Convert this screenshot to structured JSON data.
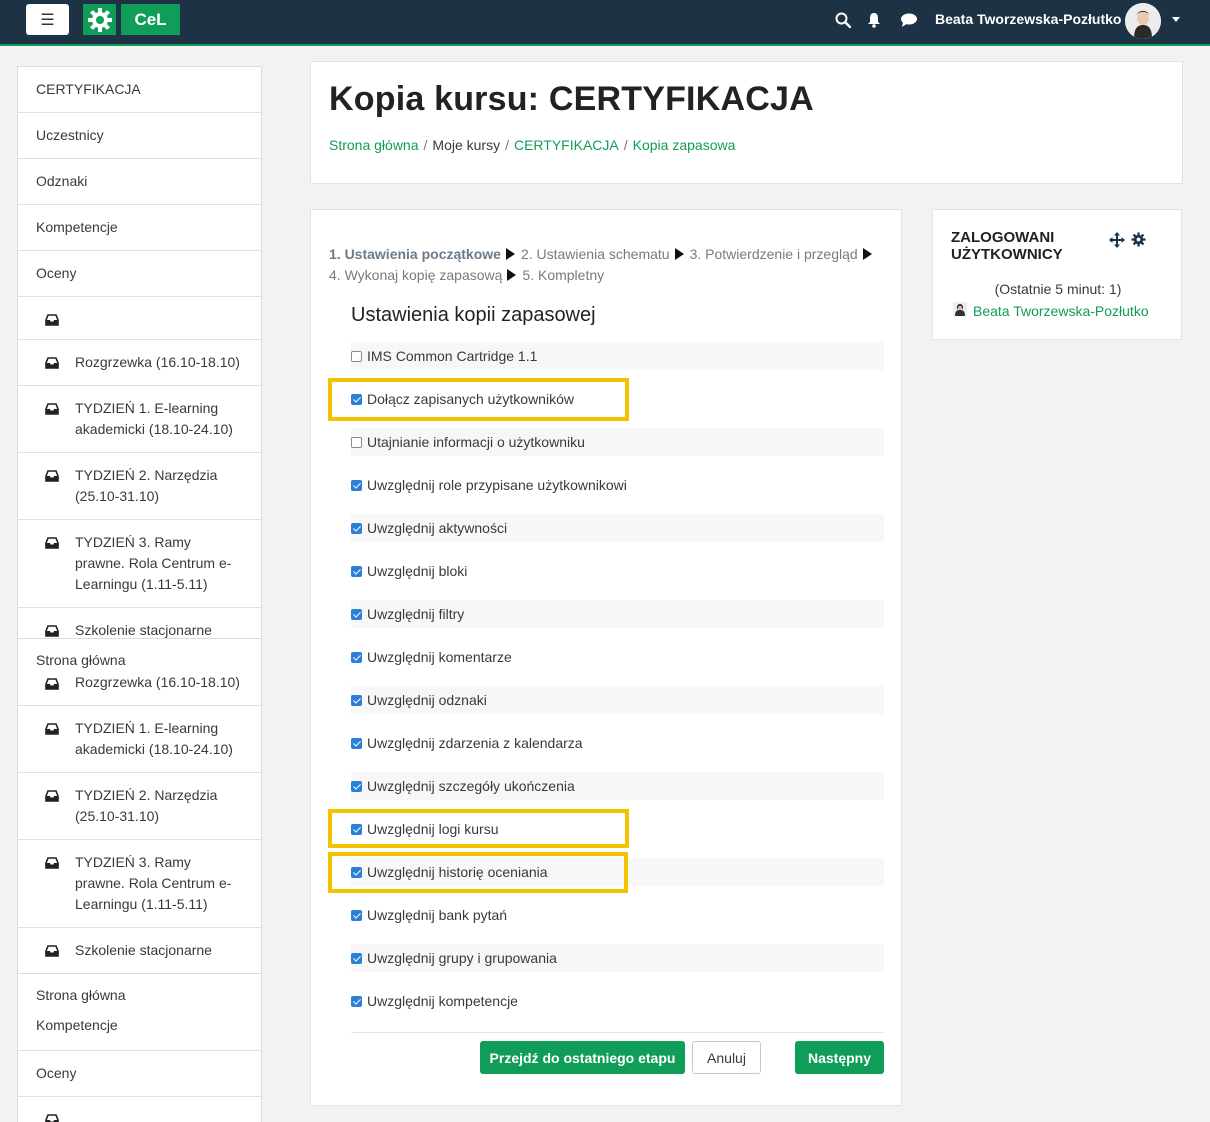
{
  "navbar": {
    "logo_text": "CeL",
    "user_name": "Beata Tworzewska-Pozłutko",
    "icons": [
      "menu-icon",
      "gear-logo-icon",
      "search-icon",
      "bell-icon",
      "chat-icon",
      "chevron-down-icon"
    ]
  },
  "sidebar": {
    "box1": [
      {
        "label": "CERTYFIKACJA"
      },
      {
        "label": "Uczestnicy"
      },
      {
        "label": "Odznaki"
      },
      {
        "label": "Kompetencje"
      },
      {
        "label": "Oceny"
      },
      {
        "label": ""
      },
      {
        "label": "Rozgrzewka (16.10-18.10)"
      },
      {
        "label": "TYDZIEŃ 1. E-learning akademicki (18.10-24.10)"
      },
      {
        "label": "TYDZIEŃ 2. Narzędzia (25.10-31.10)"
      },
      {
        "label": "TYDZIEŃ 3. Ramy prawne. Rola Centrum e-Learningu (1.11-5.11)"
      },
      {
        "label": "Szkolenie stacjonarne"
      }
    ],
    "box2": [
      {
        "label": "Strona główna"
      },
      {
        "label": "Rozgrzewka (16.10-18.10)"
      },
      {
        "label": "TYDZIEŃ 1. E-learning akademicki (18.10-24.10)"
      },
      {
        "label": "TYDZIEŃ 2. Narzędzia (25.10-31.10)"
      },
      {
        "label": "TYDZIEŃ 3. Ramy prawne. Rola Centrum e-Learningu (1.11-5.11)"
      },
      {
        "label": "Szkolenie stacjonarne"
      }
    ],
    "box3": [
      {
        "label": "Strona główna"
      },
      {
        "label": "Kompetencje"
      },
      {
        "label": "Oceny"
      },
      {
        "label": ""
      }
    ]
  },
  "header": {
    "title": "Kopia kursu: CERTYFIKACJA",
    "breadcrumb": [
      "Strona główna",
      "Moje kursy",
      "CERTYFIKACJA",
      "Kopia zapasowa"
    ]
  },
  "steps": [
    "1. Ustawienia początkowe",
    "2. Ustawienia schematu",
    "3. Potwierdzenie i przegląd",
    "4. Wykonaj kopię zapasową",
    "5. Kompletny"
  ],
  "settings": {
    "title": "Ustawienia kopii zapasowej",
    "options": [
      {
        "label": "IMS Common Cartridge 1.1",
        "checked": false
      },
      {
        "label": "Dołącz zapisanych użytkowników",
        "checked": true
      },
      {
        "label": "Utajnianie informacji o użytkowniku",
        "checked": false
      },
      {
        "label": "Uwzględnij role przypisane użytkownikowi",
        "checked": true
      },
      {
        "label": "Uwzględnij aktywności",
        "checked": true
      },
      {
        "label": "Uwzględnij bloki",
        "checked": true
      },
      {
        "label": "Uwzględnij filtry",
        "checked": true
      },
      {
        "label": "Uwzględnij komentarze",
        "checked": true
      },
      {
        "label": "Uwzględnij odznaki",
        "checked": true
      },
      {
        "label": "Uwzględnij zdarzenia z kalendarza",
        "checked": true
      },
      {
        "label": "Uwzględnij szczegóły ukończenia",
        "checked": true
      },
      {
        "label": "Uwzględnij logi kursu",
        "checked": true
      },
      {
        "label": "Uwzględnij historię oceniania",
        "checked": true
      },
      {
        "label": "Uwzględnij bank pytań",
        "checked": true
      },
      {
        "label": "Uwzględnij grupy i grupowania",
        "checked": true
      },
      {
        "label": "Uwzględnij kompetencje",
        "checked": true
      }
    ]
  },
  "buttons": {
    "final": "Przejdź do ostatniego etapu",
    "cancel": "Anuluj",
    "next": "Następny"
  },
  "online_block": {
    "title": "ZALOGOWANI UŻYTKOWNICY",
    "last": "(Ostatnie 5 minut: 1)",
    "user": "Beata Tworzewska-Pozłutko"
  },
  "colors": {
    "navbar": "#1e3246",
    "accent": "#0f9d58",
    "highlight": "#f5c200",
    "checkbox": "#2b7fd6"
  }
}
